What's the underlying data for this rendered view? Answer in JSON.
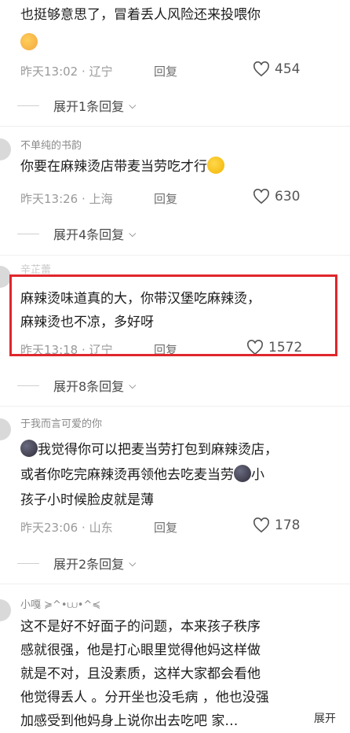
{
  "comments": [
    {
      "user": "",
      "text_lines": [
        "也挺够意思了，冒着丢人风险还来投喂你"
      ],
      "time": "昨天13:02",
      "location": "辽宁",
      "reply_label": "回复",
      "likes": "454",
      "expand": "展开1条回复"
    },
    {
      "user": "不单纯的书韵",
      "text_lines": [
        "你要在麻辣烫店带麦当劳吃才行"
      ],
      "time": "昨天13:26",
      "location": "上海",
      "reply_label": "回复",
      "likes": "630",
      "expand": "展开4条回复"
    },
    {
      "user": "辛芷蕾",
      "text_lines": [
        "麻辣烫味道真的大，你带汉堡吃麻辣烫，",
        "麻辣烫也不凉，多好呀"
      ],
      "time": "昨天13:18",
      "location": "辽宁",
      "reply_label": "回复",
      "likes": "1572",
      "expand": "展开8条回复"
    },
    {
      "user": "于我而言可爱的你",
      "text_lines": [
        "我觉得你可以把麦当劳打包到麻辣烫店，",
        "或者你吃完麻辣烫再领他去吃麦当劳",
        "小",
        "孩子小时候脸皮就是薄"
      ],
      "time": "昨天23:06",
      "location": "山东",
      "reply_label": "回复",
      "likes": "178",
      "expand": "展开2条回复"
    },
    {
      "user": "小嘎 ≽^•⩊•^≼",
      "text_lines": [
        "这不是好不好面子的问题，本来孩子秩序",
        "感就很强，他是打心眼里觉得他妈这样做",
        "就是不对，且没素质，这样大家都会看他",
        "他觉得丢人 。分开坐也没毛病 ，他也没强",
        "加感受到他妈身上说你出去吃吧 家…"
      ]
    }
  ],
  "bottom_expand": "展开",
  "sep": "·",
  "colors": {
    "highlight": "#e0262c"
  }
}
